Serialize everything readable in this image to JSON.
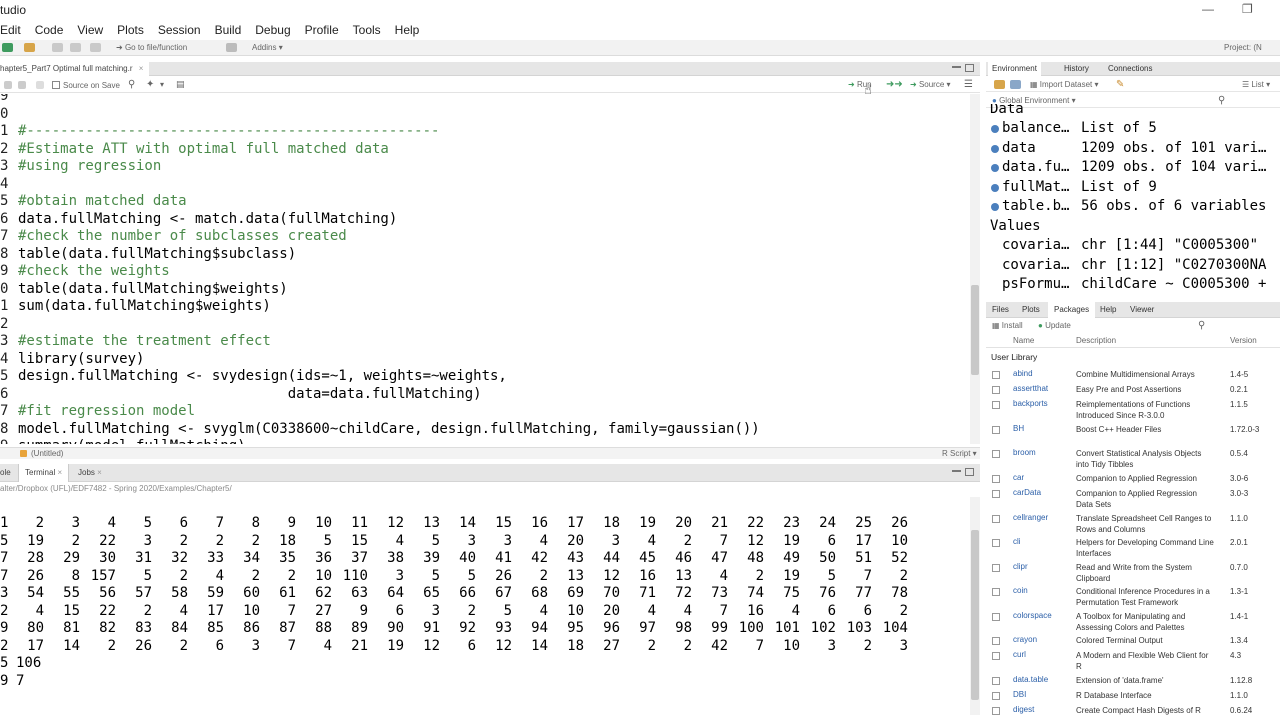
{
  "titlebar": {
    "title": "tudio"
  },
  "menu": [
    "Edit",
    "Code",
    "View",
    "Plots",
    "Session",
    "Build",
    "Debug",
    "Profile",
    "Tools",
    "Help"
  ],
  "toolbar": {
    "goto_placeholder": "Go to file/function",
    "addins": "Addins",
    "project": "Project: (N"
  },
  "editor": {
    "tab_label": "hapter5_Part7 Optimal full matching.r",
    "source_on_save": "Source on Save",
    "run_label": "Run",
    "source_label": "Source",
    "status_left": "(Untitled)",
    "status_right": "R Script",
    "lines": [
      {
        "n": "9",
        "code": ""
      },
      {
        "n": "0",
        "code": ""
      },
      {
        "n": "1",
        "code": "#-------------------------------------------------"
      },
      {
        "n": "2",
        "code": "#Estimate ATT with optimal full matched data"
      },
      {
        "n": "3",
        "code": "#using regression"
      },
      {
        "n": "4",
        "code": ""
      },
      {
        "n": "5",
        "code": "#obtain matched data"
      },
      {
        "n": "6",
        "code": "data.fullMatching <- match.data(fullMatching)"
      },
      {
        "n": "7",
        "code": "#check the number of subclasses created"
      },
      {
        "n": "8",
        "code": "table(data.fullMatching$subclass)"
      },
      {
        "n": "9",
        "code": "#check the weights"
      },
      {
        "n": "0",
        "code": "table(data.fullMatching$weights)"
      },
      {
        "n": "1",
        "code": "sum(data.fullMatching$weights)"
      },
      {
        "n": "2",
        "code": ""
      },
      {
        "n": "3",
        "code": "#estimate the treatment effect"
      },
      {
        "n": "4",
        "code": "library(survey)"
      },
      {
        "n": "5",
        "code": "design.fullMatching <- svydesign(ids=~1, weights=~weights,"
      },
      {
        "n": "6",
        "code": "                                data=data.fullMatching)"
      },
      {
        "n": "7",
        "code": "#fit regression model"
      },
      {
        "n": "8",
        "code": "model.fullMatching <- svyglm(C0338600~childCare, design.fullMatching, family=gaussian())"
      },
      {
        "n": "9",
        "code": "summary(model.fullMatching)"
      }
    ]
  },
  "console": {
    "tabs": [
      "ole",
      "Terminal",
      "Jobs"
    ],
    "path": "alter/Dropbox (UFL)/EDF7482 - Spring 2020/Examples/Chapter5/",
    "rows": [
      [
        "1",
        "2",
        "3",
        "4",
        "5",
        "6",
        "7",
        "8",
        "9",
        "10",
        "11",
        "12",
        "13",
        "14",
        "15",
        "16",
        "17",
        "18",
        "19",
        "20",
        "21",
        "22",
        "23",
        "24",
        "25",
        "26"
      ],
      [
        "5",
        "19",
        "2",
        "22",
        "3",
        "2",
        "2",
        "2",
        "18",
        "5",
        "15",
        "4",
        "5",
        "3",
        "3",
        "4",
        "20",
        "3",
        "4",
        "2",
        "7",
        "12",
        "19",
        "6",
        "17",
        "10"
      ],
      [
        "7",
        "28",
        "29",
        "30",
        "31",
        "32",
        "33",
        "34",
        "35",
        "36",
        "37",
        "38",
        "39",
        "40",
        "41",
        "42",
        "43",
        "44",
        "45",
        "46",
        "47",
        "48",
        "49",
        "50",
        "51",
        "52"
      ],
      [
        "7",
        "26",
        "8",
        "157",
        "5",
        "2",
        "4",
        "2",
        "2",
        "10",
        "110",
        "3",
        "5",
        "5",
        "26",
        "2",
        "13",
        "12",
        "16",
        "13",
        "4",
        "2",
        "19",
        "5",
        "7",
        "2"
      ],
      [
        "3",
        "54",
        "55",
        "56",
        "57",
        "58",
        "59",
        "60",
        "61",
        "62",
        "63",
        "64",
        "65",
        "66",
        "67",
        "68",
        "69",
        "70",
        "71",
        "72",
        "73",
        "74",
        "75",
        "76",
        "77",
        "78"
      ],
      [
        "2",
        "4",
        "15",
        "22",
        "2",
        "4",
        "17",
        "10",
        "7",
        "27",
        "9",
        "6",
        "3",
        "2",
        "5",
        "4",
        "10",
        "20",
        "4",
        "4",
        "7",
        "16",
        "4",
        "6",
        "6",
        "2"
      ],
      [
        "9",
        "80",
        "81",
        "82",
        "83",
        "84",
        "85",
        "86",
        "87",
        "88",
        "89",
        "90",
        "91",
        "92",
        "93",
        "94",
        "95",
        "96",
        "97",
        "98",
        "99",
        "100",
        "101",
        "102",
        "103",
        "104"
      ],
      [
        "2",
        "17",
        "14",
        "2",
        "26",
        "2",
        "6",
        "3",
        "7",
        "4",
        "21",
        "19",
        "12",
        "6",
        "12",
        "14",
        "18",
        "27",
        "2",
        "2",
        "42",
        "7",
        "10",
        "3",
        "2",
        "3"
      ],
      [
        "5",
        "106"
      ],
      [
        "9",
        "7"
      ]
    ]
  },
  "environment": {
    "tabs": [
      "Environment",
      "History",
      "Connections"
    ],
    "import_label": "Import Dataset",
    "list_label": "List",
    "scope": "Global Environment",
    "data_header": "Data",
    "values_header": "Values",
    "data": [
      {
        "name": "balance…",
        "value": "List of 5"
      },
      {
        "name": "data",
        "value": "1209 obs. of 101 vari…"
      },
      {
        "name": "data.fu…",
        "value": "1209 obs. of 104 vari…"
      },
      {
        "name": "fullMat…",
        "value": "List of 9"
      },
      {
        "name": "table.b…",
        "value": "56 obs. of 6 variables"
      }
    ],
    "values": [
      {
        "name": "covaria…",
        "value": "chr [1:44] \"C0005300\""
      },
      {
        "name": "covaria…",
        "value": "chr [1:12] \"C0270300NA"
      },
      {
        "name": "psFormu…",
        "value": "childCare ~ C0005300 +"
      }
    ]
  },
  "files": {
    "tabs": [
      "Files",
      "Plots",
      "Packages",
      "Help",
      "Viewer"
    ],
    "install_label": "Install",
    "update_label": "Update",
    "col_name": "Name",
    "col_desc": "Description",
    "col_version": "Version",
    "section": "User Library",
    "packages": [
      {
        "name": "abind",
        "desc": "Combine Multidimensional Arrays",
        "ver": "1.4-5"
      },
      {
        "name": "assertthat",
        "desc": "Easy Pre and Post Assertions",
        "ver": "0.2.1"
      },
      {
        "name": "backports",
        "desc": "Reimplementations of Functions Introduced Since R-3.0.0",
        "ver": "1.1.5"
      },
      {
        "name": "BH",
        "desc": "Boost C++ Header Files",
        "ver": "1.72.0-3"
      },
      {
        "name": "broom",
        "desc": "Convert Statistical Analysis Objects into Tidy Tibbles",
        "ver": "0.5.4"
      },
      {
        "name": "car",
        "desc": "Companion to Applied Regression",
        "ver": "3.0-6"
      },
      {
        "name": "carData",
        "desc": "Companion to Applied Regression Data Sets",
        "ver": "3.0-3"
      },
      {
        "name": "cellranger",
        "desc": "Translate Spreadsheet Cell Ranges to Rows and Columns",
        "ver": "1.1.0"
      },
      {
        "name": "cli",
        "desc": "Helpers for Developing Command Line Interfaces",
        "ver": "2.0.1"
      },
      {
        "name": "clipr",
        "desc": "Read and Write from the System Clipboard",
        "ver": "0.7.0"
      },
      {
        "name": "coin",
        "desc": "Conditional Inference Procedures in a Permutation Test Framework",
        "ver": "1.3-1"
      },
      {
        "name": "colorspace",
        "desc": "A Toolbox for Manipulating and Assessing Colors and Palettes",
        "ver": "1.4-1"
      },
      {
        "name": "crayon",
        "desc": "Colored Terminal Output",
        "ver": "1.3.4"
      },
      {
        "name": "curl",
        "desc": "A Modern and Flexible Web Client for R",
        "ver": "4.3"
      },
      {
        "name": "data.table",
        "desc": "Extension of 'data.frame'",
        "ver": "1.12.8"
      },
      {
        "name": "DBI",
        "desc": "R Database Interface",
        "ver": "1.1.0"
      },
      {
        "name": "digest",
        "desc": "Create Compact Hash Digests of R",
        "ver": "0.6.24"
      }
    ]
  },
  "colors": {
    "comment": "#4a8a4a",
    "pkg_link": "#2b5fa8",
    "pane_tab_bg": "#e6e6e6"
  }
}
